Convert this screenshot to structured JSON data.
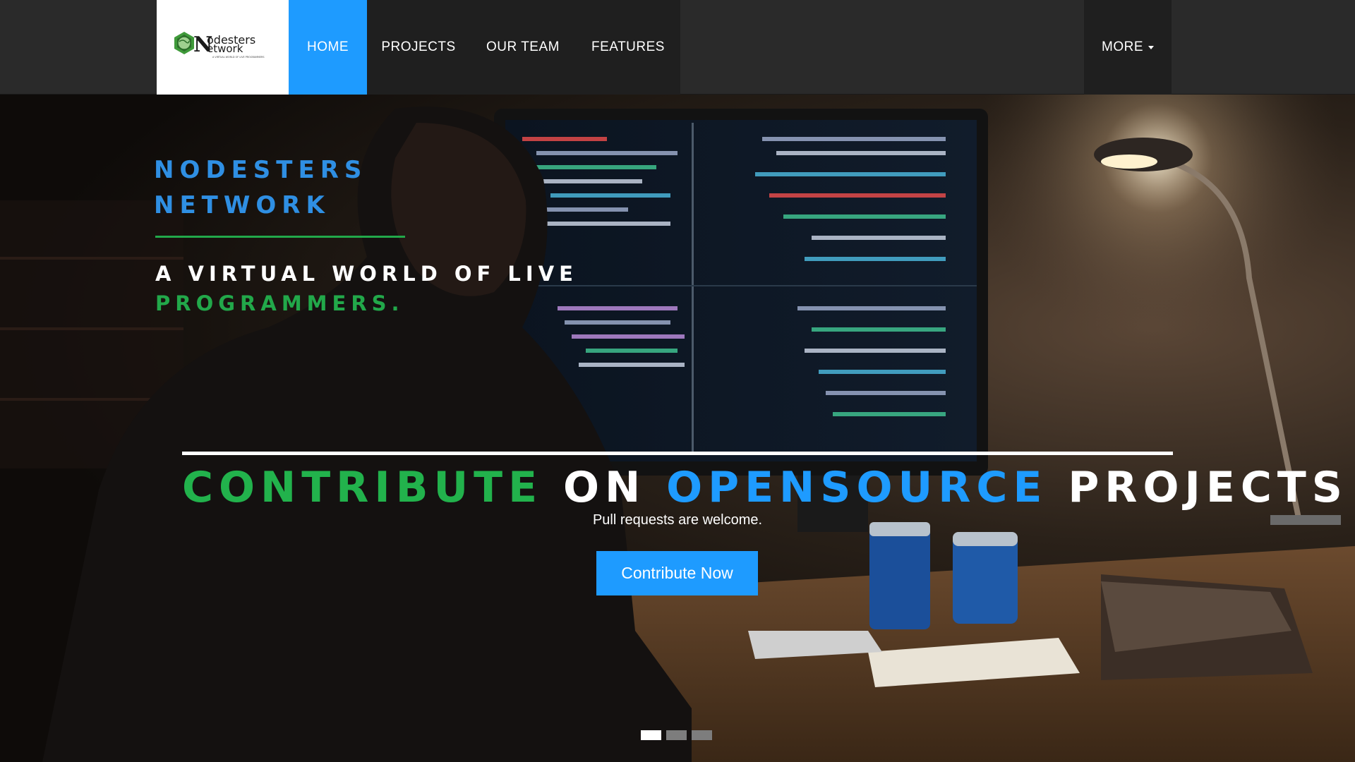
{
  "brand": {
    "logo_text_line1": "odesters",
    "logo_text_line2": "etwork",
    "logo_letter": "N",
    "logo_tagline": "A VIRTUAL WORLD OF LIVE PROGRAMMERS"
  },
  "nav": {
    "items": [
      {
        "label": "HOME",
        "active": true
      },
      {
        "label": "PROJECTS",
        "active": false
      },
      {
        "label": "OUR TEAM",
        "active": false
      },
      {
        "label": "FEATURES",
        "active": false
      }
    ],
    "more_label": "MORE"
  },
  "hero": {
    "title_line1": "NODESTERS",
    "title_line2": "NETWORK",
    "tagline_line1": "A VIRTUAL WORLD OF LIVE",
    "tagline_line2": "PROGRAMMERS.",
    "headline": {
      "word1": "CONTRIBUTE",
      "word2": "ON",
      "word3": "OPENSOURCE",
      "word4": "PROJECTS"
    },
    "subtitle": "Pull requests are welcome.",
    "cta_label": "Contribute Now",
    "carousel": {
      "count": 3,
      "active": 1
    }
  },
  "colors": {
    "accent_blue": "#1e9bff",
    "accent_green": "#22a84a",
    "navbar_bg": "#2a2a2a"
  }
}
